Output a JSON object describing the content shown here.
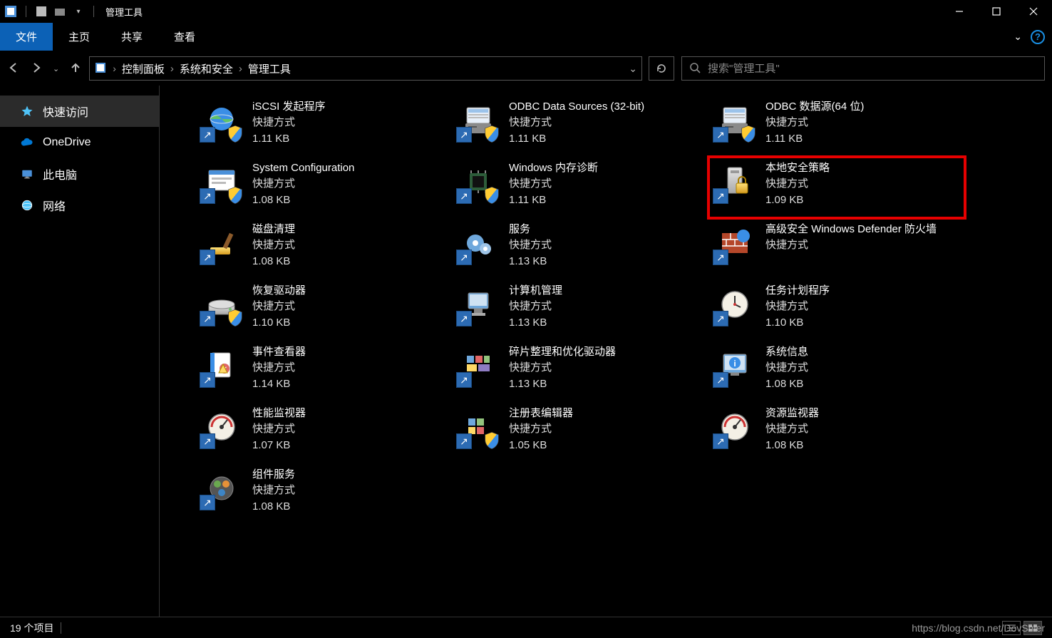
{
  "window": {
    "title": "管理工具"
  },
  "ribbon": {
    "file": "文件",
    "tabs": [
      "主页",
      "共享",
      "查看"
    ]
  },
  "breadcrumb": [
    "控制面板",
    "系统和安全",
    "管理工具"
  ],
  "search": {
    "placeholder": "搜索\"管理工具\""
  },
  "sidebar": {
    "items": [
      {
        "label": "快速访问",
        "icon": "star",
        "active": true
      },
      {
        "label": "OneDrive",
        "icon": "cloud",
        "active": false
      },
      {
        "label": "此电脑",
        "icon": "pc",
        "active": false
      },
      {
        "label": "网络",
        "icon": "network",
        "active": false
      }
    ]
  },
  "files": [
    {
      "name": "iSCSI 发起程序",
      "type": "快捷方式",
      "size": "1.11 KB",
      "icon": "globe",
      "shield": true
    },
    {
      "name": "ODBC Data Sources (32-bit)",
      "type": "快捷方式",
      "size": "1.11 KB",
      "icon": "odbc",
      "shield": true
    },
    {
      "name": "ODBC 数据源(64 位)",
      "type": "快捷方式",
      "size": "1.11 KB",
      "icon": "odbc",
      "shield": true
    },
    {
      "name": "System Configuration",
      "type": "快捷方式",
      "size": "1.08 KB",
      "icon": "sysconfig",
      "shield": true
    },
    {
      "name": "Windows 内存诊断",
      "type": "快捷方式",
      "size": "1.11 KB",
      "icon": "chip",
      "shield": true
    },
    {
      "name": "本地安全策略",
      "type": "快捷方式",
      "size": "1.09 KB",
      "icon": "secpol",
      "shield": false,
      "highlight": true
    },
    {
      "name": "磁盘清理",
      "type": "快捷方式",
      "size": "1.08 KB",
      "icon": "brush",
      "shield": false
    },
    {
      "name": "服务",
      "type": "快捷方式",
      "size": "1.13 KB",
      "icon": "gears",
      "shield": false
    },
    {
      "name": "高级安全 Windows Defender 防火墙",
      "type": "快捷方式",
      "size": "",
      "icon": "firewall",
      "shield": false
    },
    {
      "name": "恢复驱动器",
      "type": "快捷方式",
      "size": "1.10 KB",
      "icon": "drive",
      "shield": true
    },
    {
      "name": "计算机管理",
      "type": "快捷方式",
      "size": "1.13 KB",
      "icon": "compmgmt",
      "shield": false
    },
    {
      "name": "任务计划程序",
      "type": "快捷方式",
      "size": "1.10 KB",
      "icon": "clock",
      "shield": false
    },
    {
      "name": "事件查看器",
      "type": "快捷方式",
      "size": "1.14 KB",
      "icon": "eventlog",
      "shield": false
    },
    {
      "name": "碎片整理和优化驱动器",
      "type": "快捷方式",
      "size": "1.13 KB",
      "icon": "defrag",
      "shield": false
    },
    {
      "name": "系统信息",
      "type": "快捷方式",
      "size": "1.08 KB",
      "icon": "sysinfo",
      "shield": false
    },
    {
      "name": "性能监视器",
      "type": "快捷方式",
      "size": "1.07 KB",
      "icon": "gauge",
      "shield": false
    },
    {
      "name": "注册表编辑器",
      "type": "快捷方式",
      "size": "1.05 KB",
      "icon": "regedit",
      "shield": true
    },
    {
      "name": "资源监视器",
      "type": "快捷方式",
      "size": "1.08 KB",
      "icon": "gauge",
      "shield": false
    },
    {
      "name": "组件服务",
      "type": "快捷方式",
      "size": "1.08 KB",
      "icon": "component",
      "shield": false
    }
  ],
  "status": {
    "text": "19 个项目"
  },
  "watermark": "https://blog.csdn.net/DovSnier"
}
